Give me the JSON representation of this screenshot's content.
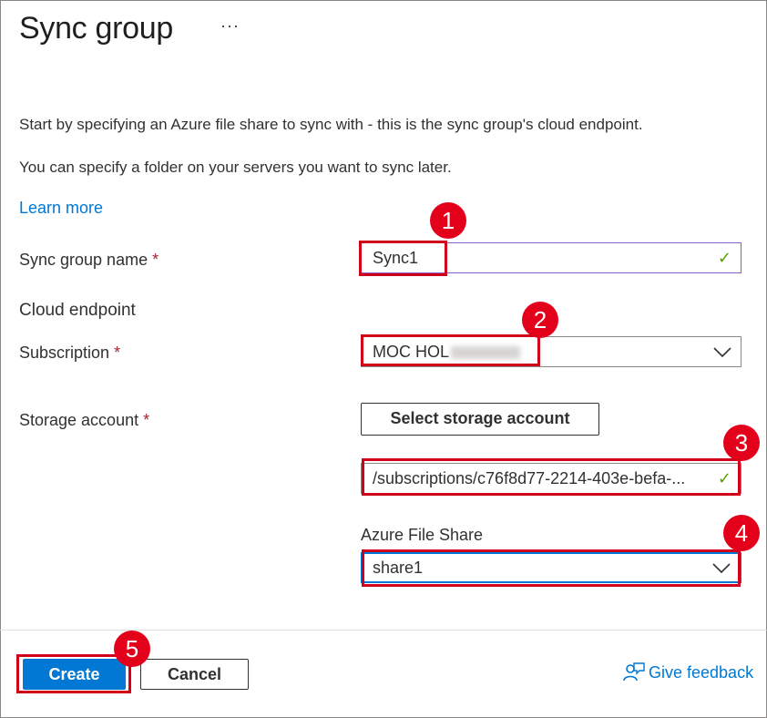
{
  "page": {
    "title": "Sync group",
    "more_label": "···",
    "description_1": "Start by specifying an Azure file share to sync with - this is the sync group's cloud endpoint.",
    "description_2": "You can specify a folder on your servers you want to sync later.",
    "learn_more": "Learn more"
  },
  "form": {
    "sync_group_name": {
      "label": "Sync group name",
      "required": "*",
      "value": "Sync1",
      "status": "✓"
    },
    "cloud_endpoint_heading": "Cloud endpoint",
    "subscription": {
      "label": "Subscription",
      "required": "*",
      "value": "MOC HOL"
    },
    "storage_account": {
      "label": "Storage account",
      "required": "*",
      "select_button": "Select storage account",
      "path_value": "/subscriptions/c76f8d77-2214-403e-befa-...",
      "status": "✓"
    },
    "azure_file_share": {
      "label": "Azure File Share",
      "value": "share1"
    }
  },
  "footer": {
    "create_label": "Create",
    "cancel_label": "Cancel",
    "feedback_label": "Give feedback"
  },
  "annotations": {
    "badge_1": "1",
    "badge_2": "2",
    "badge_3": "3",
    "badge_4": "4",
    "badge_5": "5",
    "highlight_color": "#d0021b",
    "badge_color": "#e3001b"
  },
  "colors": {
    "accent": "#0078d4",
    "success": "#57a300",
    "required": "#a4262c"
  },
  "icons": {
    "more": "more-ellipsis-icon",
    "check": "checkmark-icon",
    "dropdown": "chevron-down-icon",
    "feedback": "feedback-person-icon"
  }
}
